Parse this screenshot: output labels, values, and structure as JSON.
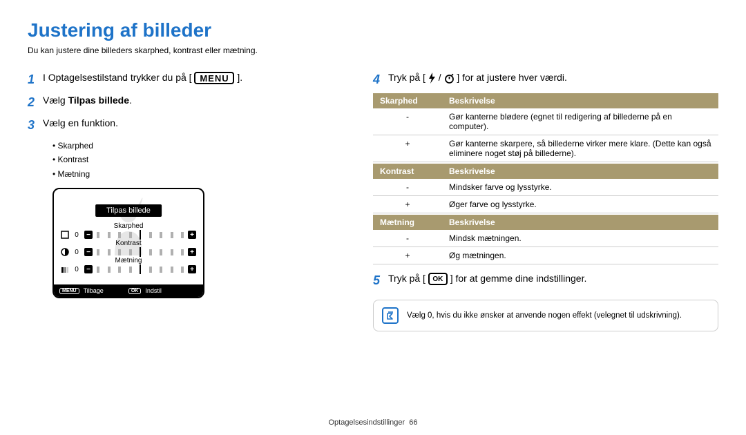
{
  "title": "Justering af billeder",
  "subtitle": "Du kan justere dine billeders skarphed, kontrast eller mætning.",
  "left": {
    "step1_pre": "I Optagelsestilstand trykker du på [",
    "step1_post": "].",
    "menu_label": "MENU",
    "step2_pre": "Vælg ",
    "step2_bold": "Tilpas billede",
    "step2_post": ".",
    "step3": "Vælg en funktion.",
    "bullets": [
      "Skarphed",
      "Kontrast",
      "Mætning"
    ],
    "scr": {
      "title": "Tilpas billede",
      "rows": [
        {
          "label": "Skarphed",
          "val": "0"
        },
        {
          "label": "Kontrast",
          "val": "0"
        },
        {
          "label": "Mætning",
          "val": "0"
        }
      ],
      "back": "Tilbage",
      "set": "Indstil",
      "menu": "MENU",
      "ok": "OK"
    }
  },
  "right": {
    "step4_pre": "Tryk på [",
    "step4_mid": "/",
    "step4_post": "] for at justere hver værdi.",
    "tables": [
      {
        "h1": "Skarphed",
        "h2": "Beskrivelse",
        "rows": [
          {
            "sign": "-",
            "text": "Gør kanterne blødere (egnet til redigering af billederne på en computer)."
          },
          {
            "sign": "+",
            "text": "Gør kanterne skarpere, så billederne virker mere klare. (Dette kan også eliminere noget støj på billederne)."
          }
        ]
      },
      {
        "h1": "Kontrast",
        "h2": "Beskrivelse",
        "rows": [
          {
            "sign": "-",
            "text": "Mindsker farve og lysstyrke."
          },
          {
            "sign": "+",
            "text": "Øger farve og lysstyrke."
          }
        ]
      },
      {
        "h1": "Mætning",
        "h2": "Beskrivelse",
        "rows": [
          {
            "sign": "-",
            "text": "Mindsk mætningen."
          },
          {
            "sign": "+",
            "text": "Øg mætningen."
          }
        ]
      }
    ],
    "step5_pre": "Tryk på [",
    "step5_post": "] for at gemme dine indstillinger.",
    "ok_label": "OK",
    "note": "Vælg 0, hvis du ikke ønsker at anvende nogen effekt (velegnet til udskrivning)."
  },
  "footer": {
    "section": "Optagelsesindstillinger",
    "page": "66"
  }
}
